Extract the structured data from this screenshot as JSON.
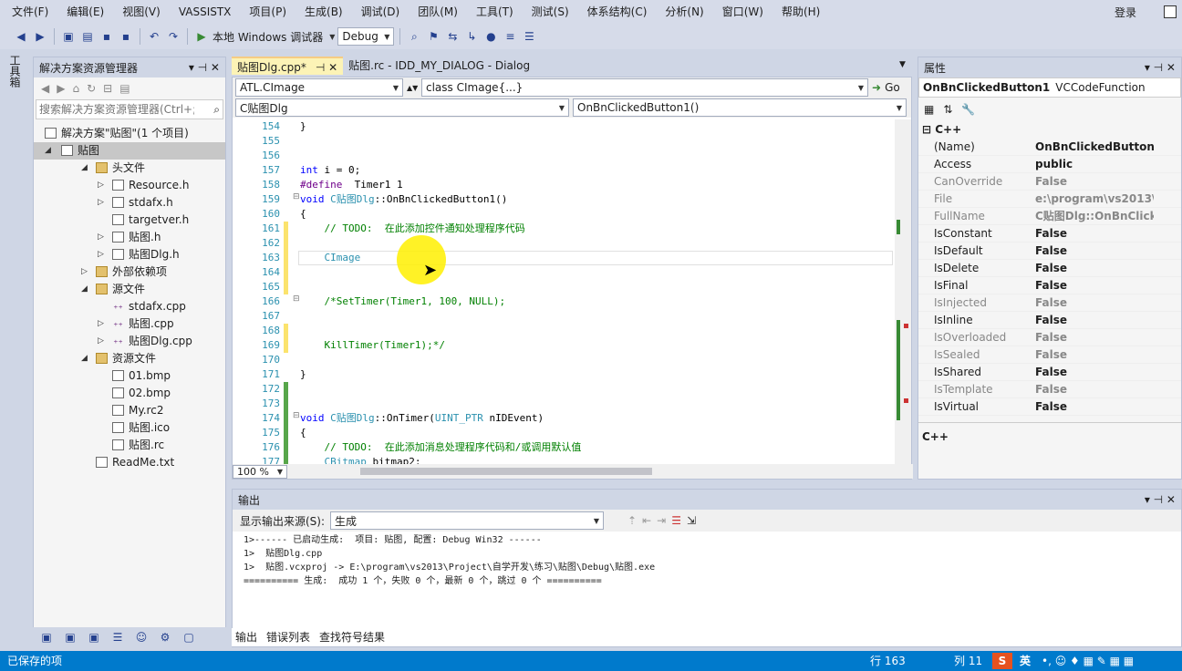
{
  "menu": [
    "文件(F)",
    "编辑(E)",
    "视图(V)",
    "VASSISTX",
    "项目(P)",
    "生成(B)",
    "调试(D)",
    "团队(M)",
    "工具(T)",
    "测试(S)",
    "体系结构(C)",
    "分析(N)",
    "窗口(W)",
    "帮助(H)"
  ],
  "login": "登录",
  "toolbar": {
    "debugger": "本地 Windows 调试器",
    "config": "Debug"
  },
  "left_tab": "工具箱",
  "solution_explorer": {
    "title": "解决方案资源管理器",
    "search_placeholder": "搜索解决方案资源管理器(Ctrl+;)",
    "solution": "解决方案\"贴图\"(1 个项目)",
    "project": "贴图",
    "items": [
      {
        "label": "头文件",
        "level": 2,
        "type": "folder",
        "arrow": "▲"
      },
      {
        "label": "Resource.h",
        "level": 3,
        "type": "file",
        "arrow": "▷"
      },
      {
        "label": "stdafx.h",
        "level": 3,
        "type": "file",
        "arrow": "▷"
      },
      {
        "label": "targetver.h",
        "level": 3,
        "type": "file",
        "arrow": ""
      },
      {
        "label": "贴图.h",
        "level": 3,
        "type": "file",
        "arrow": "▷"
      },
      {
        "label": "贴图Dlg.h",
        "level": 3,
        "type": "file",
        "arrow": "▷"
      },
      {
        "label": "外部依赖项",
        "level": 2,
        "type": "folder",
        "arrow": "▷"
      },
      {
        "label": "源文件",
        "level": 2,
        "type": "folder",
        "arrow": "▲"
      },
      {
        "label": "stdafx.cpp",
        "level": 3,
        "type": "cpp",
        "arrow": ""
      },
      {
        "label": "贴图.cpp",
        "level": 3,
        "type": "cpp",
        "arrow": "▷"
      },
      {
        "label": "贴图Dlg.cpp",
        "level": 3,
        "type": "cpp",
        "arrow": "▷"
      },
      {
        "label": "资源文件",
        "level": 2,
        "type": "folder",
        "arrow": "▲"
      },
      {
        "label": "01.bmp",
        "level": 3,
        "type": "file",
        "arrow": ""
      },
      {
        "label": "02.bmp",
        "level": 3,
        "type": "file",
        "arrow": ""
      },
      {
        "label": "My.rc2",
        "level": 3,
        "type": "file",
        "arrow": ""
      },
      {
        "label": "贴图.ico",
        "level": 3,
        "type": "file",
        "arrow": ""
      },
      {
        "label": "贴图.rc",
        "level": 3,
        "type": "file",
        "arrow": ""
      },
      {
        "label": "ReadMe.txt",
        "level": 2,
        "type": "file",
        "arrow": ""
      }
    ]
  },
  "doc_tabs": [
    {
      "label": "贴图Dlg.cpp*",
      "pin": "⊣ ✕",
      "active": true
    },
    {
      "label": "贴图.rc - IDD_MY_DIALOG - Dialog",
      "pin": "",
      "active": false
    }
  ],
  "editor": {
    "nav1": "ATL.CImage",
    "nav2": "class CImage{...}",
    "go": "Go",
    "nav3": "C贴图Dlg",
    "nav4": "OnBnClickedButton1()",
    "zoom": "100 %",
    "line_numbers": [
      "154",
      "155",
      "156",
      "157",
      "158",
      "159",
      "160",
      "161",
      "162",
      "163",
      "164",
      "165",
      "166",
      "167",
      "168",
      "169",
      "170",
      "171",
      "172",
      "173",
      "174",
      "175",
      "176",
      "177"
    ],
    "lines": [
      "}",
      "",
      "",
      "int i = 0;",
      "#define  Timer1 1",
      "void C贴图Dlg::OnBnClickedButton1()",
      "{",
      "    // TODO:  在此添加控件通知处理程序代码",
      "",
      "    CImage",
      "",
      "",
      "    /*SetTimer(Timer1, 100, NULL);",
      "",
      "",
      "    KillTimer(Timer1);*/",
      "",
      "}",
      "",
      "",
      "void C贴图Dlg::OnTimer(UINT_PTR nIDEvent)",
      "{",
      "    // TODO:  在此添加消息处理程序代码和/或调用默认值",
      "    CBitmap bitmap2;"
    ]
  },
  "properties": {
    "title": "属性",
    "object": "OnBnClickedButton1",
    "object_type": "VCCodeFunction",
    "category": "C++",
    "rows": [
      {
        "name": "(Name)",
        "value": "OnBnClickedButton1",
        "dim": false
      },
      {
        "name": "Access",
        "value": "public",
        "dim": false
      },
      {
        "name": "CanOverride",
        "value": "False",
        "dim": true
      },
      {
        "name": "File",
        "value": "e:\\program\\vs2013\\p",
        "dim": true
      },
      {
        "name": "FullName",
        "value": "C贴图Dlg::OnBnClicke",
        "dim": true
      },
      {
        "name": "IsConstant",
        "value": "False",
        "dim": false
      },
      {
        "name": "IsDefault",
        "value": "False",
        "dim": false
      },
      {
        "name": "IsDelete",
        "value": "False",
        "dim": false
      },
      {
        "name": "IsFinal",
        "value": "False",
        "dim": false
      },
      {
        "name": "IsInjected",
        "value": "False",
        "dim": true
      },
      {
        "name": "IsInline",
        "value": "False",
        "dim": false
      },
      {
        "name": "IsOverloaded",
        "value": "False",
        "dim": true
      },
      {
        "name": "IsSealed",
        "value": "False",
        "dim": true
      },
      {
        "name": "IsShared",
        "value": "False",
        "dim": false
      },
      {
        "name": "IsTemplate",
        "value": "False",
        "dim": true
      },
      {
        "name": "IsVirtual",
        "value": "False",
        "dim": false
      }
    ],
    "description": "C++"
  },
  "output": {
    "title": "输出",
    "source_label": "显示输出来源(S):",
    "source_value": "生成",
    "lines": [
      "1>------ 已启动生成:  项目: 贴图, 配置: Debug Win32 ------",
      "1>  贴图Dlg.cpp",
      "1>  贴图.vcxproj -> E:\\program\\vs2013\\Project\\自学开发\\练习\\贴图\\Debug\\贴图.exe",
      "========== 生成:  成功 1 个，失败 0 个，最新 0 个，跳过 0 个 =========="
    ],
    "tabs": [
      "输出",
      "错误列表",
      "查找符号结果"
    ]
  },
  "status": {
    "left": "已保存的项",
    "line": "行 163",
    "col": "列 11",
    "ime": "英"
  }
}
